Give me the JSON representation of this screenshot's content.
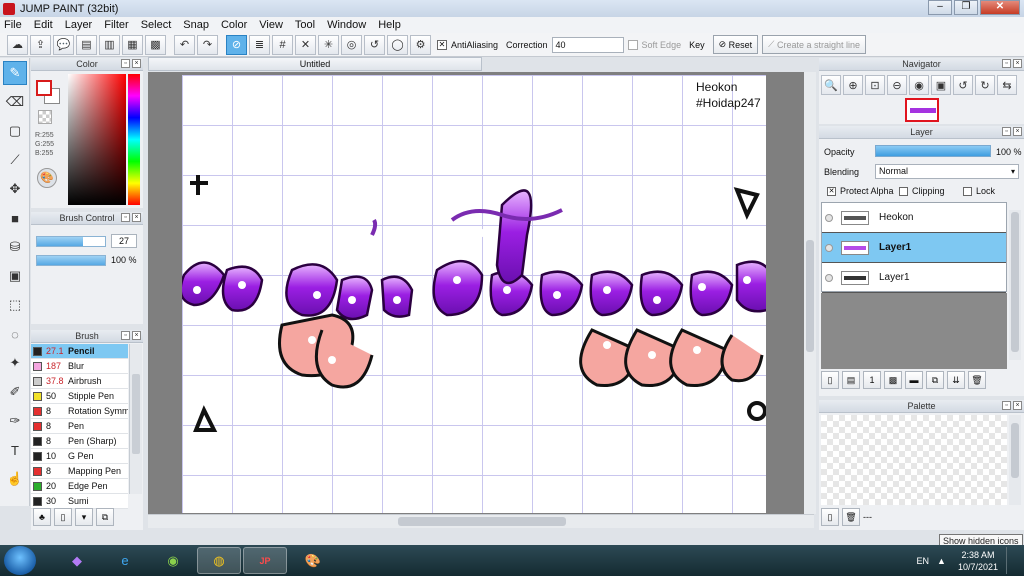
{
  "window": {
    "title": "JUMP PAINT (32bit)"
  },
  "menu": [
    "File",
    "Edit",
    "Layer",
    "Filter",
    "Select",
    "Snap",
    "Color",
    "View",
    "Tool",
    "Window",
    "Help"
  ],
  "toolbar": {
    "antialiasing_label": "AntiAliasing",
    "correction_label": "Correction",
    "correction_value": "40",
    "soft_edge_label": "Soft Edge",
    "key_label": "Key",
    "reset_label": "Reset",
    "straight_line_label": "Create a straight line"
  },
  "color_panel": {
    "title": "Color",
    "r": "R:255",
    "g": "G:255",
    "b": "B:255"
  },
  "brush_control": {
    "title": "Brush Control",
    "size_value": "27",
    "size_fraction": 0.68,
    "opacity_value": "100 %",
    "opacity_fraction": 1.0
  },
  "brush_panel": {
    "title": "Brush",
    "items": [
      {
        "size": "27.1",
        "name": "Pencil",
        "color": "#222222",
        "selected": true,
        "red": true
      },
      {
        "size": "187",
        "name": "Blur",
        "color": "#f4a6e0",
        "selected": false,
        "red": true
      },
      {
        "size": "37.8",
        "name": "Airbrush",
        "color": "#cccccc",
        "selected": false,
        "red": true
      },
      {
        "size": "50",
        "name": "Stipple Pen",
        "color": "#f2e22a",
        "selected": false,
        "red": false
      },
      {
        "size": "8",
        "name": "Rotation Symm",
        "color": "#e53030",
        "selected": false,
        "red": false
      },
      {
        "size": "8",
        "name": "Pen",
        "color": "#e53030",
        "selected": false,
        "red": false
      },
      {
        "size": "8",
        "name": "Pen (Sharp)",
        "color": "#222222",
        "selected": false,
        "red": false
      },
      {
        "size": "10",
        "name": "G Pen",
        "color": "#222222",
        "selected": false,
        "red": false
      },
      {
        "size": "8",
        "name": "Mapping Pen",
        "color": "#e53030",
        "selected": false,
        "red": false
      },
      {
        "size": "20",
        "name": "Edge Pen",
        "color": "#2cae2c",
        "selected": false,
        "red": false
      },
      {
        "size": "30",
        "name": "Sumi",
        "color": "#222222",
        "selected": false,
        "red": false
      }
    ]
  },
  "document": {
    "tab_title": "Untitled",
    "watermark_line1": "Heokon",
    "watermark_line2": "#Hoidap247"
  },
  "navigator": {
    "title": "Navigator"
  },
  "layer_panel": {
    "title": "Layer",
    "opacity_label": "Opacity",
    "opacity_value": "100 %",
    "opacity_fraction": 1.0,
    "blending_label": "Blending",
    "blending_value": "Normal",
    "protect_alpha_label": "Protect Alpha",
    "clipping_label": "Clipping",
    "lock_label": "Lock",
    "layers": [
      {
        "name": "Heokon",
        "selected": false,
        "thumb_color": "#555555"
      },
      {
        "name": "Layer1",
        "selected": true,
        "thumb_color": "#b54be8"
      },
      {
        "name": "Layer1",
        "selected": false,
        "thumb_color": "#333333"
      }
    ]
  },
  "palette_panel": {
    "title": "Palette",
    "footer_text": "---"
  },
  "taskbar": {
    "lang": "EN",
    "time": "2:38 AM",
    "date": "10/7/2021",
    "tooltip": "Show hidden icons",
    "apps": [
      "visual-studio-icon",
      "internet-explorer-icon",
      "coccoc-browser-icon",
      "chrome-icon",
      "jump-paint-icon",
      "paint-icon"
    ]
  }
}
